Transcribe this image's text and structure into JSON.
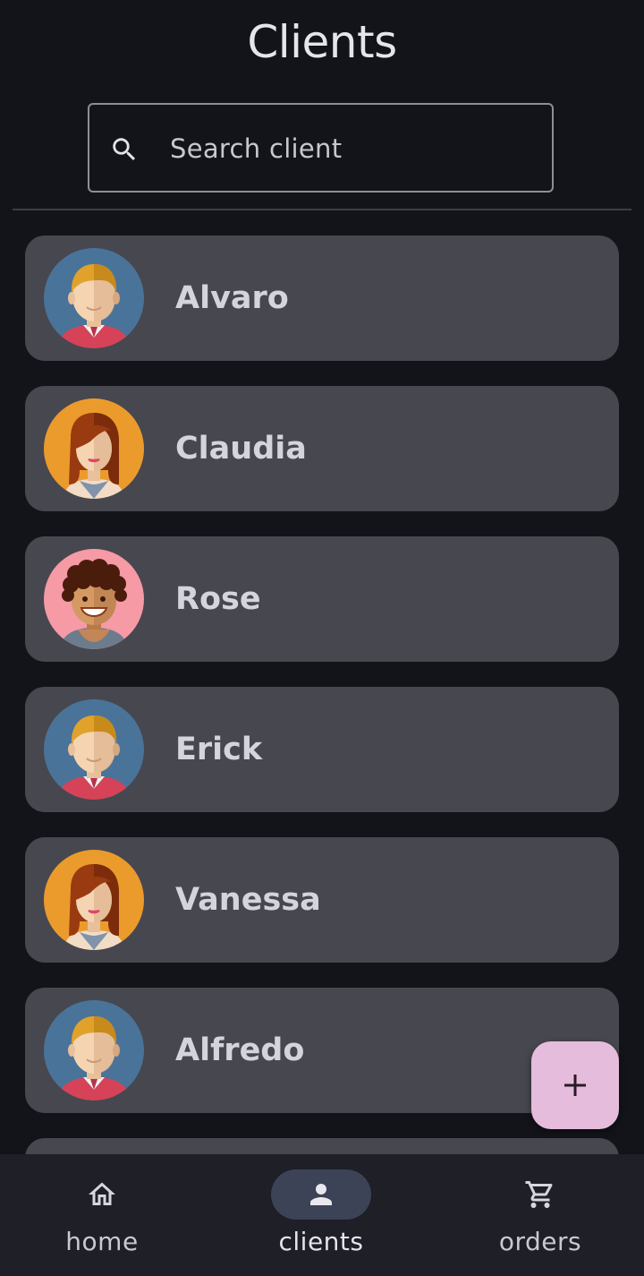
{
  "screen": {
    "title": "Clients"
  },
  "search": {
    "placeholder": "Search client",
    "icon": "search-icon"
  },
  "clients": [
    {
      "name": "Alvaro",
      "avatar": "avatar-man-blonde"
    },
    {
      "name": "Claudia",
      "avatar": "avatar-woman-redhead"
    },
    {
      "name": "Rose",
      "avatar": "avatar-curly-hair"
    },
    {
      "name": "Erick",
      "avatar": "avatar-man-blonde"
    },
    {
      "name": "Vanessa",
      "avatar": "avatar-woman-redhead"
    },
    {
      "name": "Alfredo",
      "avatar": "avatar-man-blonde"
    }
  ],
  "fab": {
    "icon": "plus-icon"
  },
  "bottom_nav": {
    "home": {
      "label": "home",
      "icon": "home-icon"
    },
    "clients": {
      "label": "clients",
      "icon": "person-icon",
      "active": true
    },
    "orders": {
      "label": "orders",
      "icon": "cart-icon"
    }
  },
  "colors": {
    "background": "#13141a",
    "card": "#47474f",
    "fab": "#e5bcdb",
    "nav_bg": "#1e1f27",
    "nav_active_pill": "#3c4357"
  }
}
